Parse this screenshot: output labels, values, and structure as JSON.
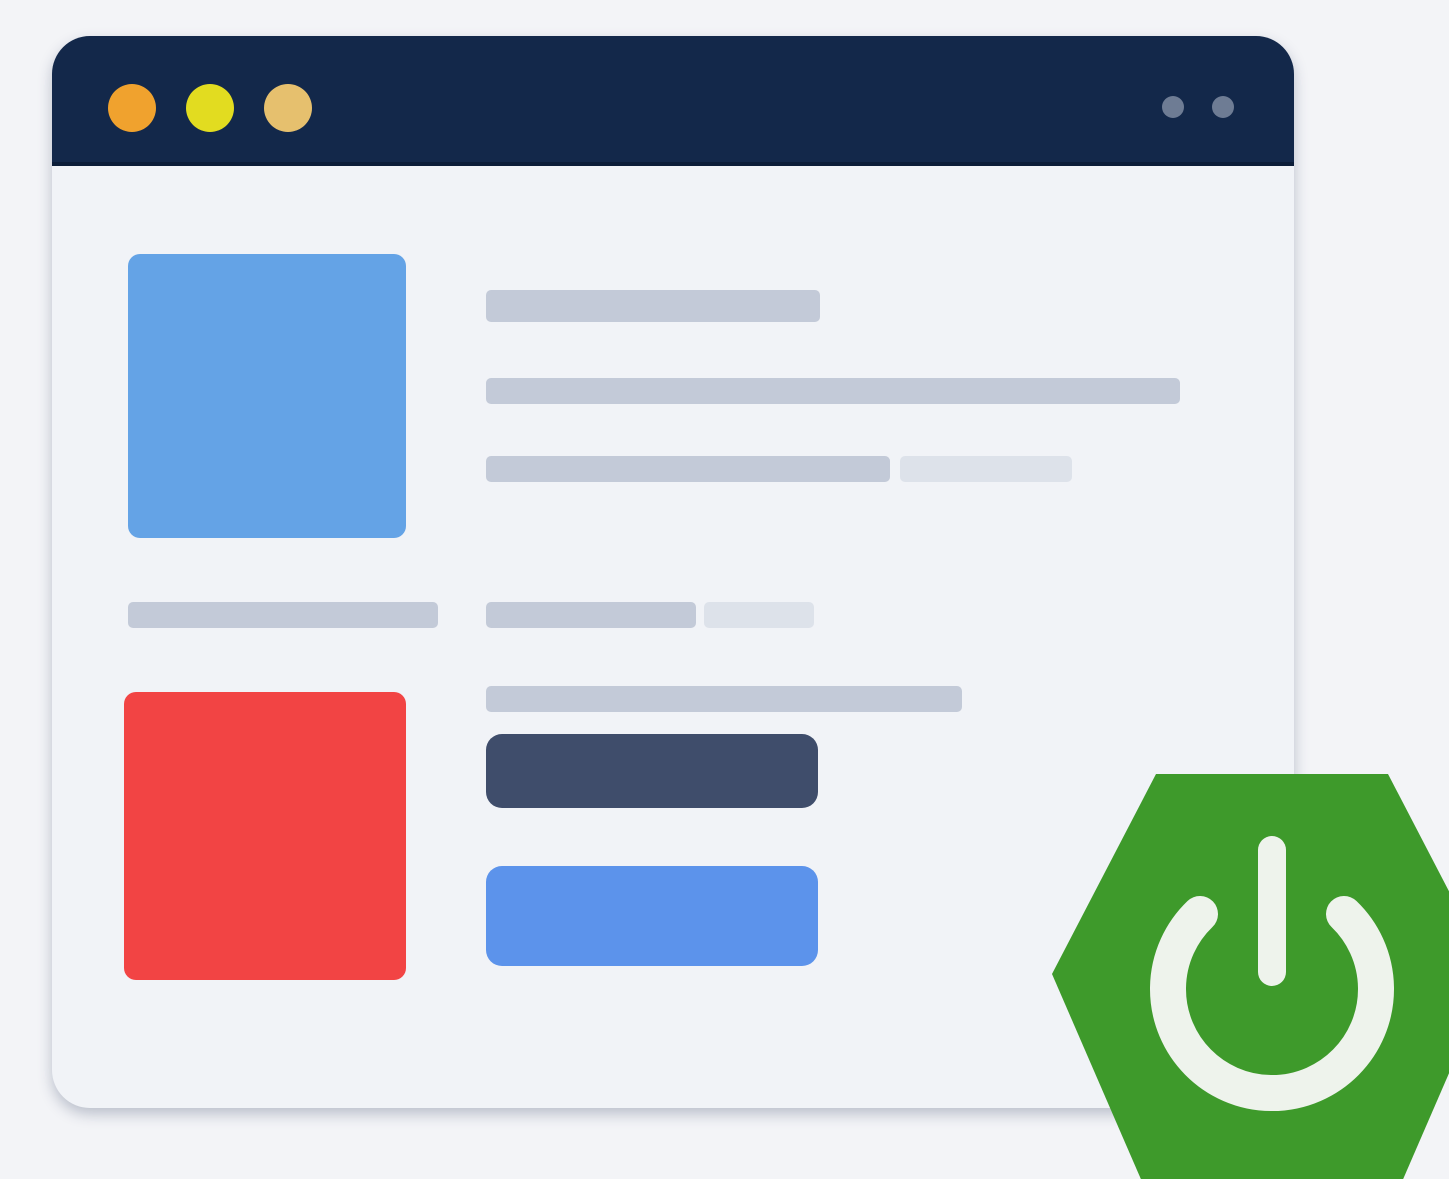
{
  "colors": {
    "titlebar": "#13284a",
    "traffic_light_1": "#f0a22e",
    "traffic_light_2": "#e2dc20",
    "traffic_light_3": "#e6c06e",
    "image_block_top": "#64a3e6",
    "image_block_bottom": "#f24444",
    "primary_button": "#3f4d6b",
    "secondary_button": "#5c93eb",
    "badge": "#3e9a2b",
    "badge_symbol": "#eef3ec"
  },
  "icons": {
    "badge": "power-icon"
  }
}
